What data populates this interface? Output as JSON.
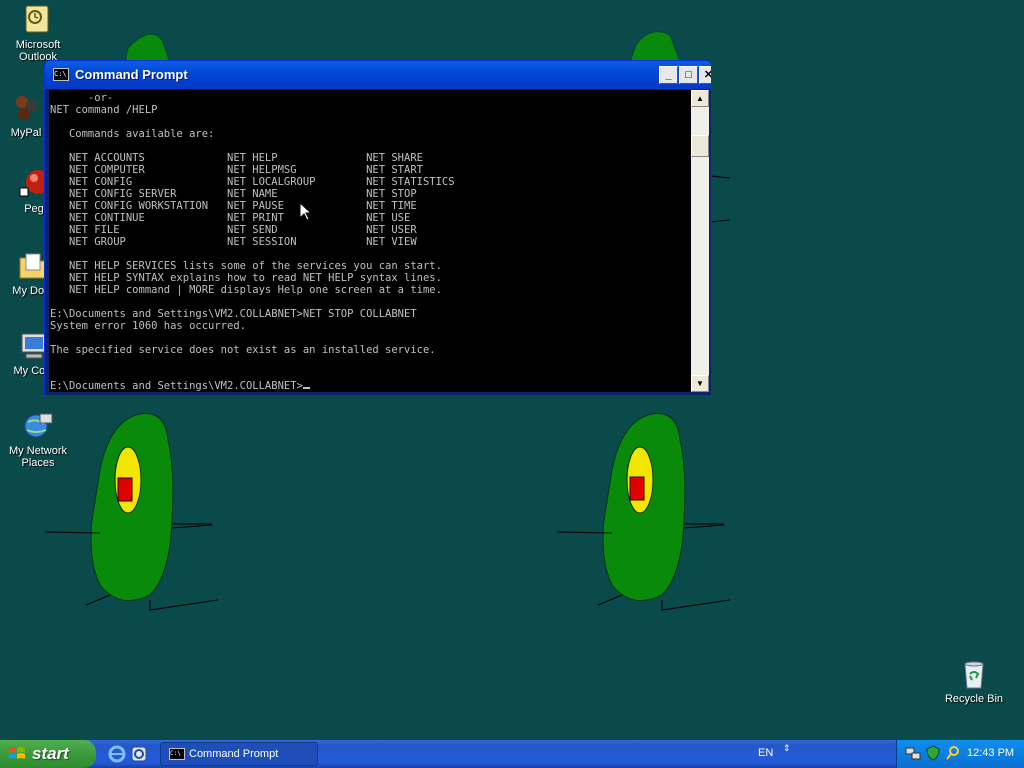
{
  "desktop": {
    "icons": [
      {
        "name": "microsoft-outlook-icon",
        "label": "Microsoft Outlook"
      },
      {
        "name": "mypal-icon",
        "label": "MyPal"
      },
      {
        "name": "peg-icon",
        "label": "Peg"
      },
      {
        "name": "my-documents-icon",
        "label": "My Docu"
      },
      {
        "name": "my-computer-icon",
        "label": "My Com"
      },
      {
        "name": "my-network-places-icon",
        "label": "My Network Places"
      },
      {
        "name": "recycle-bin-icon",
        "label": "Recycle Bin"
      }
    ]
  },
  "window": {
    "title": "Command Prompt",
    "icon_text": "C:\\",
    "minimize": "_",
    "maximize": "□",
    "close": "✕"
  },
  "console": {
    "lines": [
      "      -or-",
      "NET command /HELP",
      "",
      "   Commands available are:",
      "",
      "   NET ACCOUNTS             NET HELP              NET SHARE",
      "   NET COMPUTER             NET HELPMSG           NET START",
      "   NET CONFIG               NET LOCALGROUP        NET STATISTICS",
      "   NET CONFIG SERVER        NET NAME              NET STOP",
      "   NET CONFIG WORKSTATION   NET PAUSE             NET TIME",
      "   NET CONTINUE             NET PRINT             NET USE",
      "   NET FILE                 NET SEND              NET USER",
      "   NET GROUP                NET SESSION           NET VIEW",
      "",
      "   NET HELP SERVICES lists some of the services you can start.",
      "   NET HELP SYNTAX explains how to read NET HELP syntax lines.",
      "   NET HELP command | MORE displays Help one screen at a time.",
      "",
      "E:\\Documents and Settings\\VM2.COLLABNET>NET STOP COLLABNET",
      "System error 1060 has occurred.",
      "",
      "The specified service does not exist as an installed service.",
      "",
      ""
    ],
    "prompt": "E:\\Documents and Settings\\VM2.COLLABNET>"
  },
  "taskbar": {
    "start_label": "start",
    "tasks": [
      {
        "label": "Command Prompt"
      }
    ],
    "language": "EN",
    "clock": "12:43 PM"
  },
  "colors": {
    "desktop": "#0b4a4a",
    "figure_green": "#0a8a0a",
    "figure_yellow": "#f2e600",
    "figure_red": "#e00000"
  }
}
